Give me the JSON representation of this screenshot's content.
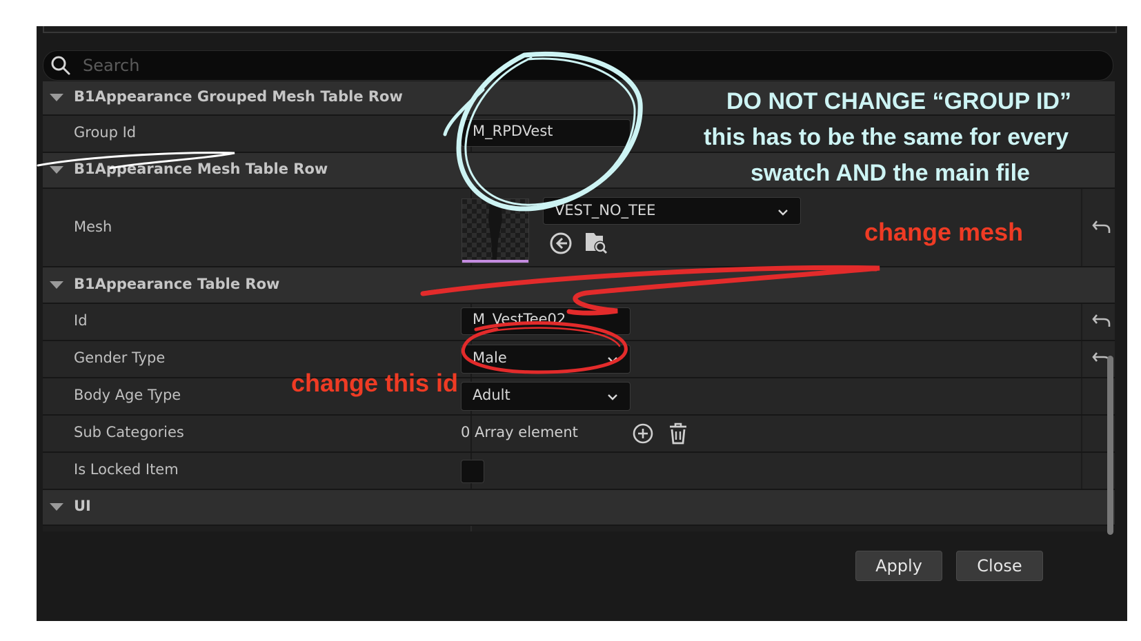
{
  "search": {
    "placeholder": "Search"
  },
  "sections": {
    "grouped": {
      "title": "B1Appearance Grouped Mesh Table Row",
      "group_id_label": "Group Id",
      "group_id_value": "M_RPDVest"
    },
    "mesh": {
      "title": "B1Appearance Mesh Table Row",
      "mesh_label": "Mesh",
      "mesh_value": "VEST_NO_TEE"
    },
    "table": {
      "title": "B1Appearance Table Row",
      "id_label": "Id",
      "id_value": "M_VestTee02",
      "gender_label": "Gender Type",
      "gender_value": "Male",
      "body_age_label": "Body Age Type",
      "body_age_value": "Adult",
      "sub_categories_label": "Sub Categories",
      "sub_categories_value": "0 Array element",
      "locked_label": "Is Locked Item"
    },
    "ui": {
      "title": "UI"
    }
  },
  "buttons": {
    "apply": "Apply",
    "close": "Close"
  },
  "annotations": {
    "group_warning_line1": "DO NOT CHANGE “GROUP ID”",
    "group_warning_line2": "this has to be the same for every",
    "group_warning_line3": "swatch AND the main file",
    "change_mesh": "change mesh",
    "change_id": "change this id"
  },
  "colors": {
    "annotation_blue": "#cdf4f4",
    "annotation_red": "#ef3b24",
    "scribble_red": "#e32b2b"
  },
  "icons": [
    "search-icon",
    "chevron-down-icon",
    "reset-arrow-icon",
    "use-selected-icon",
    "browse-icon",
    "add-element-icon",
    "trash-icon",
    "collapse-triangle-icon"
  ]
}
